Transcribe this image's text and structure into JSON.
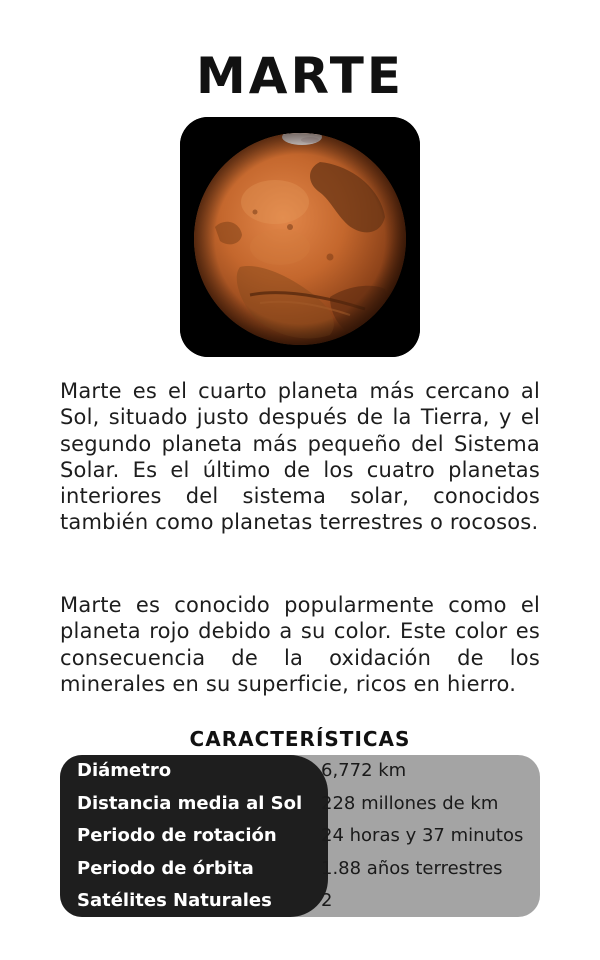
{
  "title": "MARTE",
  "image": {
    "subject": "planet-mars-photo"
  },
  "paragraphs": [
    "Marte es el cuarto planeta más cercano al Sol, situado justo después de la Tierra, y el segundo planeta más pequeño del Sistema Solar. Es el último de los cuatro planetas interiores del sistema solar, conocidos también como planetas terrestres o rocosos.",
    "Marte es conocido popularmente como el planeta rojo debido a su color. Este color es consecuencia de la oxidación de los minerales en su superficie, ricos en hierro."
  ],
  "characteristics": {
    "heading": "CARACTERÍSTICAS",
    "rows": [
      {
        "label": "Diámetro",
        "value": "6,772 km"
      },
      {
        "label": "Distancia media al Sol",
        "value": "228 millones de km"
      },
      {
        "label": "Periodo de rotación",
        "value": "24 horas y 37 minutos"
      },
      {
        "label": "Periodo de órbita",
        "value": "1.88 años terrestres"
      },
      {
        "label": "Satélites Naturales",
        "value": "2"
      }
    ]
  },
  "colors": {
    "table_dark": "#1e1e1e",
    "table_light": "#a4a4a4",
    "planet": "#c0652a"
  }
}
